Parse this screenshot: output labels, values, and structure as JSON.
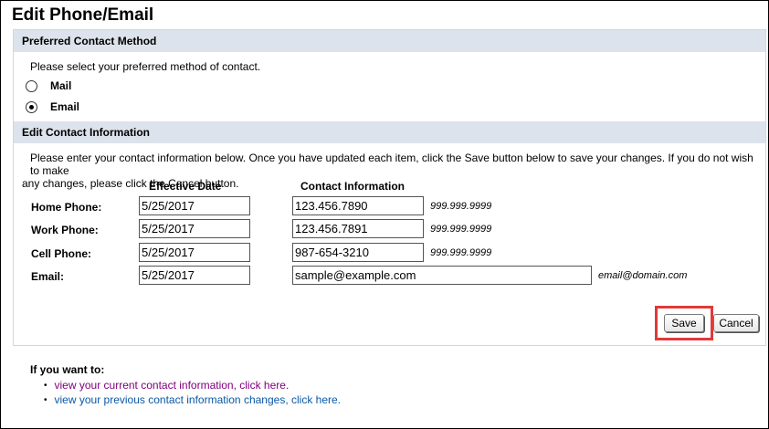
{
  "page": {
    "title": "Edit Phone/Email"
  },
  "preferred": {
    "header": "Preferred Contact Method",
    "instruction": "Please select your preferred method of contact.",
    "options": [
      {
        "label": "Mail",
        "checked": false
      },
      {
        "label": "Email",
        "checked": true
      }
    ]
  },
  "edit": {
    "header": "Edit Contact Information",
    "instruction_line1": "Please enter your contact information below. Once you have updated each item, click the Save button below to save your changes. If you do not wish to make",
    "instruction_line2": "any changes, please click the Cancel button.",
    "col_effective": "Effective Date",
    "col_contact": "Contact Information",
    "rows": [
      {
        "label": "Home Phone:",
        "date": "5/25/2017",
        "value": "123.456.7890",
        "hint": "999.999.9999"
      },
      {
        "label": "Work Phone:",
        "date": "5/25/2017",
        "value": "123.456.7891",
        "hint": "999.999.9999"
      },
      {
        "label": "Cell Phone:",
        "date": "5/25/2017",
        "value": "987-654-3210",
        "hint": "999.999.9999"
      },
      {
        "label": "Email:",
        "date": "5/25/2017",
        "value": "sample@example.com",
        "hint": "email@domain.com"
      }
    ],
    "save_label": "Save",
    "cancel_label": "Cancel"
  },
  "footer": {
    "title": "If you want to:",
    "links": [
      {
        "text": "view your current contact information, click here.",
        "color": "#800080"
      },
      {
        "text": "view your previous contact information changes, click here.",
        "color": "#0a58a6"
      }
    ]
  },
  "colors": {
    "section_header_bg": "#dde3ec",
    "highlight_border": "#e0393a",
    "visited_link": "#800080",
    "link": "#0a58a6"
  }
}
